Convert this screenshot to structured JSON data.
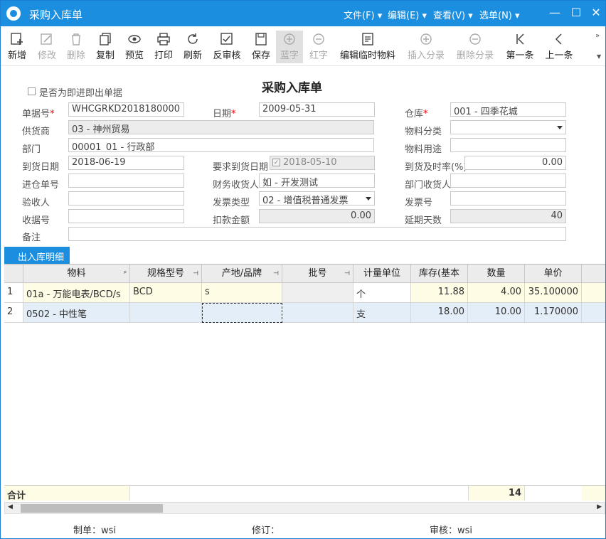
{
  "window": {
    "title": "采购入库单",
    "menus": [
      "文件(F)",
      "编辑(E)",
      "查看(V)",
      "选单(N)"
    ]
  },
  "toolbar": {
    "buttons": [
      "新增",
      "修改",
      "删除",
      "复制",
      "预览",
      "打印",
      "刷新",
      "反审核",
      "保存",
      "蓝字",
      "红字",
      "编辑临时物料",
      "插入分录",
      "删除分录",
      "第一条",
      "上一条"
    ]
  },
  "form": {
    "doc_title": "采购入库单",
    "checkbox_label": "是否为即进即出单据",
    "labels": {
      "doc_no": "单据号",
      "supplier": "供货商",
      "dept": "部门",
      "arrival_date": "到货日期",
      "entry_no": "进仓单号",
      "inspector": "验收人",
      "receipt_no": "收据号",
      "remark": "备注",
      "date": "日期",
      "req_date": "要求到货日期",
      "fin_receiver": "财务收货人",
      "invoice_type": "发票类型",
      "deduction": "扣款金额",
      "warehouse": "仓库",
      "material_cat": "物料分类",
      "material_use": "物料用途",
      "ontime_rate": "到货及时率(%)",
      "dept_receiver": "部门收货人",
      "invoice_no": "发票号",
      "delay_days": "延期天数"
    },
    "values": {
      "doc_no": "WHCGRKD2018180000",
      "supplier": "03 - 神州贸易",
      "dept": "00001_01 - 行政部",
      "arrival_date": "2018-06-19",
      "entry_no": "",
      "inspector": "",
      "receipt_no": "",
      "remark": "",
      "date": "2009-05-31",
      "req_date": "2018-05-10",
      "fin_receiver": "如 - 开发测试",
      "invoice_type": "02 - 增值税普通发票",
      "deduction": "0.00",
      "warehouse": "001 - 四季花城",
      "material_cat": "",
      "material_use": "",
      "ontime_rate": "0.00",
      "dept_receiver": "",
      "invoice_no": "",
      "delay_days": "40"
    }
  },
  "detail": {
    "tab_label": "出入库明细",
    "columns": [
      "物料",
      "规格型号",
      "产地/品牌",
      "批号",
      "计量单位",
      "库存(基本",
      "数量",
      "单价"
    ],
    "rows": [
      {
        "idx": "1",
        "material": "01a - 万能电表/BCD/s",
        "spec": "BCD",
        "origin": "s",
        "batch": "",
        "unit": "个",
        "stock": "11.88",
        "qty": "4.00",
        "price": "35.100000"
      },
      {
        "idx": "2",
        "material": "0502 - 中性笔",
        "spec": "",
        "origin": "",
        "batch": "",
        "unit": "支",
        "stock": "18.00",
        "qty": "10.00",
        "price": "1.170000"
      }
    ],
    "total_label": "合计",
    "total_qty": "14"
  },
  "status": {
    "maker": "制单：wsi",
    "revise": "修订：",
    "audit": "审核：wsi"
  }
}
